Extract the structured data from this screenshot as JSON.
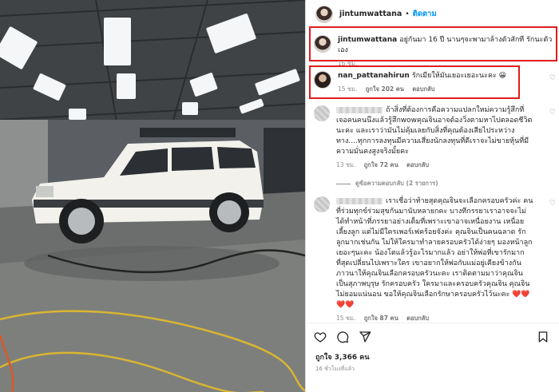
{
  "post": {
    "username": "jintumwattana",
    "dot": "•",
    "follow_label": "ติดตาม",
    "likes_text": "ถูกใจ 3,366 คน",
    "time_text": "16 ชั่วโมงที่แล้ว"
  },
  "caption": {
    "username": "jintumwattana",
    "text": "อยู่กันมา 16 ปี นานๆจะพามาล้างตัวสักที รักนะตัวเอง",
    "age": "16 ชม."
  },
  "comment1": {
    "username": "nan_pattanahirun",
    "text": "รักเมียให้มันเยอะเยอะนะคะ 😀",
    "age": "15 ชม.",
    "likes": "ถูกใจ 202 คน",
    "reply": "ตอบกลับ"
  },
  "comment2": {
    "text": "ถ้าสิ่งที่ต้องการคือความแปลกใหม่ความรู้สึกที่เจอคนคนนึงแล้วรู้สึกwowคุณจินอาจต้องวิ่งตามหาไปตลอดชีวิตนะคะ และเราว่ามันไม่คุ้มเลยกับสิ่งที่คุณต้องเสียไประหว่างทาง....ทุกการลงทุนมีความเสี่ยงนักลงทุนที่ดีเราจะไม่ขายหุ้นที่มีความมั่นคงสูงจริงมั้ยคะ",
    "age": "13 ชม.",
    "likes": "ถูกใจ 72 คน",
    "reply": "ตอบกลับ",
    "view_replies": "ดูข้อความตอบกลับ (2 รายการ)"
  },
  "comment3": {
    "text": "เราเชื่อว่าท้ายสุดคุณจินจะเลือกครอบครัวค่ะ คนที่ร่วมทุกข์ร่วมสุขกันมานับหลายกคะ บางทีกรรยาเราอาจจะไม่ได้ทำหน้าที่ภรรยาอย่างเต็มที่เพราะเขาอาจเหนื่อยงาน เหนื่อยเลี้ยงลูก แต่ไม่มีใครเพอร์เฟคร้อยจังค่ะ คุณจินเป็นคนฉลาด รักลูกมากเช่นกัน ไม่ให้ใครมาทำลายครอบครัวได้ง่ายๆ มองหน้าลูกเยอะๆนะคะ น้องโตแล้วรู้อะไรมากแล้ว อย่าให้พ่อที่เขารักมากที่สุดเปลี่ยนไปเพราะใคร เขาอยากให้พ่อกับแม่อยู่เคียงข้างกัน ภาวนาให้คุณจินเลือกครอบครัวนะคะ เราติดตามมาว่าคุณจินเป็นสุภาพบุรุษ รักครอบครัว ใครมาและครอบครัวคุณจิน คุณจินไม่ยอมแน่นอน ขอให้คุณจินเลือกรักษาครอบครัวไว้นะคะ ❤️❤️❤️❤️",
    "age": "15 ชม.",
    "likes": "ถูกใจ 87 คน",
    "reply": "ตอบกลับ"
  },
  "icons": {
    "heart": "heart-icon",
    "comment": "comment-icon",
    "share": "share-icon",
    "save": "bookmark-icon"
  },
  "colors": {
    "follow": "#0095f6",
    "highlight": "#e01d1d"
  }
}
